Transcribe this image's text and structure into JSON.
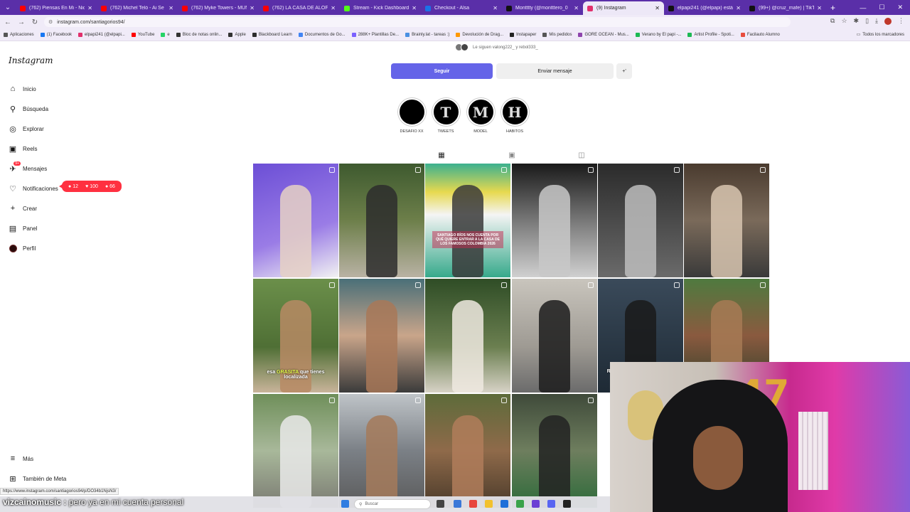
{
  "browser": {
    "tabs": [
      {
        "label": "(762) Piensas En Mi - Nicky Ja",
        "color": "#ff0000"
      },
      {
        "label": "(762) Michel Teló - Ai Se Eu Te",
        "color": "#ff0000"
      },
      {
        "label": "(762) Myke Towers - MUNDO",
        "color": "#ff0000"
      },
      {
        "label": "(762) LA CASA DE ALOFOKE 2",
        "color": "#ff0000"
      },
      {
        "label": "Stream - Kick Dashboard",
        "color": "#53fc18"
      },
      {
        "label": "Checkout - Alsa",
        "color": "#1a73e8"
      },
      {
        "label": "Montttty (@montttero_0",
        "color": "#111111"
      },
      {
        "label": "(9) Instagram",
        "color": "#e1306c",
        "active": true
      },
      {
        "label": "elpapi241 (@elpapi) está e",
        "color": "#111111"
      },
      {
        "label": "(99+) @cruz_mafe) | TikTok",
        "color": "#111111"
      }
    ],
    "url": "instagram.com/santiagorios94/",
    "bookmarks": [
      {
        "label": "Aplicaciones",
        "color": "#555555"
      },
      {
        "label": "(1) Facebook",
        "color": "#1877f2"
      },
      {
        "label": "elpapi241 (@elpapi...",
        "color": "#e1306c"
      },
      {
        "label": "YouTube",
        "color": "#ff0000"
      },
      {
        "label": "e",
        "color": "#25d366"
      },
      {
        "label": "Bloc de notas onlin...",
        "color": "#333333"
      },
      {
        "label": "Apple",
        "color": "#333333"
      },
      {
        "label": "Blackboard Learn",
        "color": "#2d2d2d"
      },
      {
        "label": "Documentos de Go...",
        "color": "#4285f4"
      },
      {
        "label": "288K+ Plantillas De...",
        "color": "#7b61ff"
      },
      {
        "label": "Brainly.lat - tareas :)",
        "color": "#4a90e2"
      },
      {
        "label": "Devolución de Drag...",
        "color": "#ff9900"
      },
      {
        "label": "Instapaper",
        "color": "#222222"
      },
      {
        "label": "Mis pedidos",
        "color": "#555555"
      },
      {
        "label": "GORE OCEAN - Mus...",
        "color": "#8e44ad"
      },
      {
        "label": "Verano by El papi -...",
        "color": "#1db954"
      },
      {
        "label": "Artist Profile - Spoti...",
        "color": "#1db954"
      },
      {
        "label": "Facilauto Alumno",
        "color": "#e84c3d"
      }
    ],
    "all_bookmarks": "Todos los marcadores",
    "status_url": "https://www.instagram.com/santiagorios94/p/DO34b1NjsN3/"
  },
  "sidebar": {
    "logo": "Instagram",
    "items": [
      {
        "label": "Inicio",
        "icon": "home-icon",
        "glyph": "⌂"
      },
      {
        "label": "Búsqueda",
        "icon": "search-icon",
        "glyph": "⚲"
      },
      {
        "label": "Explorar",
        "icon": "compass-icon",
        "glyph": "◎"
      },
      {
        "label": "Reels",
        "icon": "reels-icon",
        "glyph": "▣"
      },
      {
        "label": "Mensajes",
        "icon": "messenger-icon",
        "glyph": "✈",
        "badge": "9+"
      },
      {
        "label": "Notificaciones",
        "icon": "heart-icon",
        "glyph": "♡"
      },
      {
        "label": "Crear",
        "icon": "plus-icon",
        "glyph": "+"
      },
      {
        "label": "Panel",
        "icon": "dashboard-icon",
        "glyph": "▤"
      },
      {
        "label": "Perfil",
        "icon": "avatar",
        "glyph": ""
      }
    ],
    "more": "Más",
    "meta": "También de Meta",
    "notifications": {
      "comments": "12",
      "likes": "100",
      "follows": "66"
    }
  },
  "profile": {
    "followed_by": "Le siguen valong222_ y rebol333_",
    "follow_label": "Seguir",
    "message_label": "Enviar mensaje",
    "suggest_label": "+'",
    "highlights": [
      {
        "label": "DESAFIO XX",
        "glyph": ""
      },
      {
        "label": "TWEETS",
        "glyph": "T"
      },
      {
        "label": "MODEL",
        "glyph": "M"
      },
      {
        "label": "HABITOS",
        "glyph": "H"
      }
    ]
  },
  "posts": [
    {
      "bg": "linear-gradient(160deg,#6c4fd6 0%,#9a7ce6 60%,#f2f2f2 100%)",
      "fig": "#e6d1c4"
    },
    {
      "bg": "linear-gradient(180deg,#3e5a2f 0%,#6d7f4a 50%,#b9b2a4 100%)",
      "fig": "#2d2d2d"
    },
    {
      "bg": "linear-gradient(180deg,#3bb08f 0%,#e7d94f 25%,#f4f4f4 45%,#36a98b 100%)",
      "fig": "#3a3a3a",
      "caption": "SANTIAGO RÍOS NOS CUENTA POR QUÉ QUIERE ENTRAR A LA CASA DE LOS FAMOSOS COLOMBIA 2026"
    },
    {
      "bg": "linear-gradient(180deg,#1a1a1a 0%,#8a8a8a 60%,#d0d0d0 100%)",
      "fig": "#c8c8c8"
    },
    {
      "bg": "linear-gradient(180deg,#2b2b2b 0%,#6a6a6a 100%)",
      "fig": "#bdbdbd"
    },
    {
      "bg": "linear-gradient(180deg,#4a3b2f 0%,#7a6a5a 50%,#3a3a3a 100%)",
      "fig": "#d8c6b0"
    },
    {
      "bg": "linear-gradient(180deg,#6b8f4a 0%,#4f6f35 60%,#c9b49a 100%)",
      "fig": "#b78a64",
      "caption_a": "esa ",
      "caption_b": "GRASITA",
      "caption_c": " que tienes localizada"
    },
    {
      "bg": "linear-gradient(180deg,#4a6f78 0%,#c9a58a 50%,#3b3b3b 100%)",
      "fig": "#a87858"
    },
    {
      "bg": "linear-gradient(180deg,#2f4d26 0%,#6b7f50 60%,#d7d2c6 100%)",
      "fig": "#efe9e0"
    },
    {
      "bg": "linear-gradient(180deg,#c9c5bd 0%,#9e9a93 60%,#6b6b6b 100%)",
      "fig": "#1c1c1c"
    },
    {
      "bg": "linear-gradient(180deg,#3a4a5a 0%,#1e2a35 100%)",
      "fig": "#1a1a1a",
      "caption": "Rutina de Pierna Para Ganar Fuerza y Volumen 🔥"
    },
    {
      "bg": "linear-gradient(180deg,#4f7a3f 0%,#8a5a3f 50%,#2f3f2a 100%)",
      "fig": "#a77a55"
    },
    {
      "bg": "linear-gradient(180deg,#6f8f5a 0%,#a8b89a 50%,#7a7a72 100%)",
      "fig": "#e9e9e9"
    },
    {
      "bg": "linear-gradient(180deg,#bfc4c8 0%,#7b8086 50%,#5a5a5a 100%)",
      "fig": "#a57a5b"
    },
    {
      "bg": "linear-gradient(180deg,#5d6b3a 0%,#8f6a4a 50%,#4a3a2a 100%)",
      "fig": "#b07c5a"
    },
    {
      "bg": "linear-gradient(180deg,#3f4a3a 0%,#6e7e5e 50%,#2d6b3a 100%)",
      "fig": "#222222"
    }
  ],
  "subtitle": {
    "user": "vizcainomusic",
    "message": "pero ya en mi cuenta personal"
  },
  "taskbar": {
    "search_placeholder": "Buscar"
  }
}
